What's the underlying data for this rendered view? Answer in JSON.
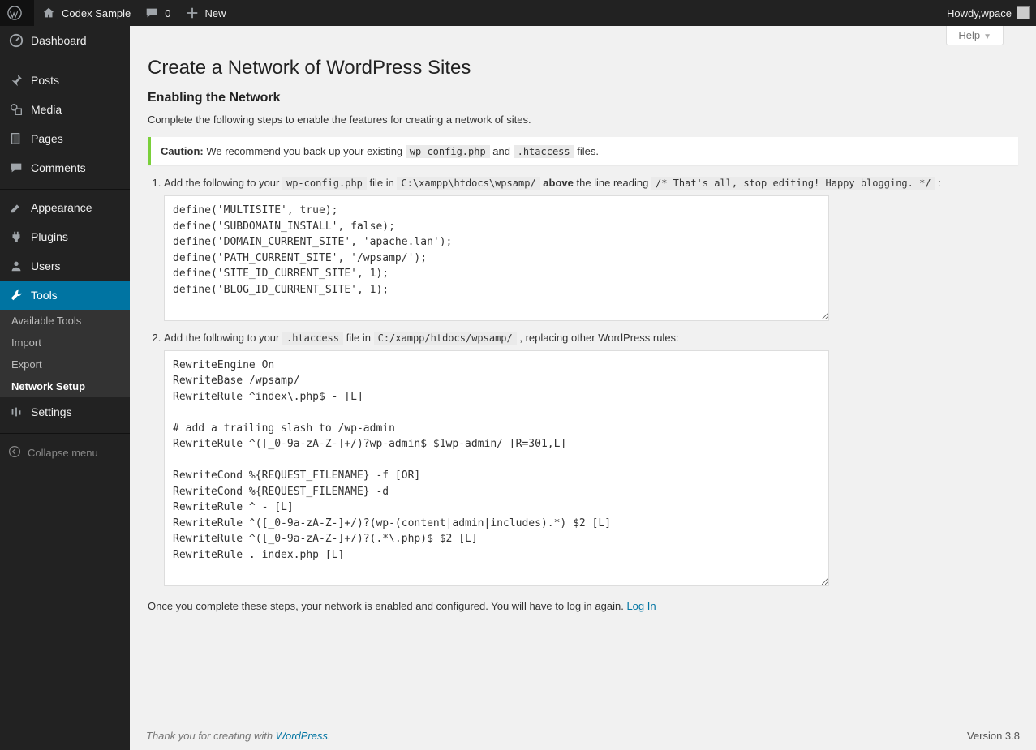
{
  "adminbar": {
    "site_title": "Codex Sample",
    "comments_count": "0",
    "new_label": "New",
    "howdy_prefix": "Howdy, ",
    "user_name": "wpace"
  },
  "sidebar": {
    "items": [
      {
        "label": "Dashboard"
      },
      {
        "label": "Posts"
      },
      {
        "label": "Media"
      },
      {
        "label": "Pages"
      },
      {
        "label": "Comments"
      },
      {
        "label": "Appearance"
      },
      {
        "label": "Plugins"
      },
      {
        "label": "Users"
      },
      {
        "label": "Tools"
      },
      {
        "label": "Settings"
      }
    ],
    "tools_submenu": [
      {
        "label": "Available Tools"
      },
      {
        "label": "Import"
      },
      {
        "label": "Export"
      },
      {
        "label": "Network Setup"
      }
    ],
    "collapse_label": "Collapse menu"
  },
  "help_tab": "Help",
  "page_title": "Create a Network of WordPress Sites",
  "section_title": "Enabling the Network",
  "lead": "Complete the following steps to enable the features for creating a network of sites.",
  "caution_label": "Caution:",
  "caution_text_1": " We recommend you back up your existing ",
  "caution_code_1": "wp-config.php",
  "caution_and": " and ",
  "caution_code_2": ".htaccess",
  "caution_text_2": " files.",
  "step1": {
    "pre": "Add the following to your ",
    "file": "wp-config.php",
    "mid1": " file in ",
    "path": "C:\\xampp\\htdocs\\wpsamp/",
    "above": "above",
    "mid2": " the line reading ",
    "comment": "/* That's all, stop editing! Happy blogging. */",
    "tail": " :",
    "code": "define('MULTISITE', true);\ndefine('SUBDOMAIN_INSTALL', false);\ndefine('DOMAIN_CURRENT_SITE', 'apache.lan');\ndefine('PATH_CURRENT_SITE', '/wpsamp/');\ndefine('SITE_ID_CURRENT_SITE', 1);\ndefine('BLOG_ID_CURRENT_SITE', 1);"
  },
  "step2": {
    "pre": "Add the following to your ",
    "file": ".htaccess",
    "mid1": " file in ",
    "path": "C:/xampp/htdocs/wpsamp/",
    "tail": " , replacing other WordPress rules:",
    "code": "RewriteEngine On\nRewriteBase /wpsamp/\nRewriteRule ^index\\.php$ - [L]\n\n# add a trailing slash to /wp-admin\nRewriteRule ^([_0-9a-zA-Z-]+/)?wp-admin$ $1wp-admin/ [R=301,L]\n\nRewriteCond %{REQUEST_FILENAME} -f [OR]\nRewriteCond %{REQUEST_FILENAME} -d\nRewriteRule ^ - [L]\nRewriteRule ^([_0-9a-zA-Z-]+/)?(wp-(content|admin|includes).*) $2 [L]\nRewriteRule ^([_0-9a-zA-Z-]+/)?(.*\\.php)$ $2 [L]\nRewriteRule . index.php [L]"
  },
  "closing_text": "Once you complete these steps, your network is enabled and configured. You will have to log in again. ",
  "login_link": "Log In",
  "footer_thanks_pre": "Thank you for creating with ",
  "footer_thanks_link": "WordPress",
  "footer_thanks_post": ".",
  "footer_version": "Version 3.8"
}
